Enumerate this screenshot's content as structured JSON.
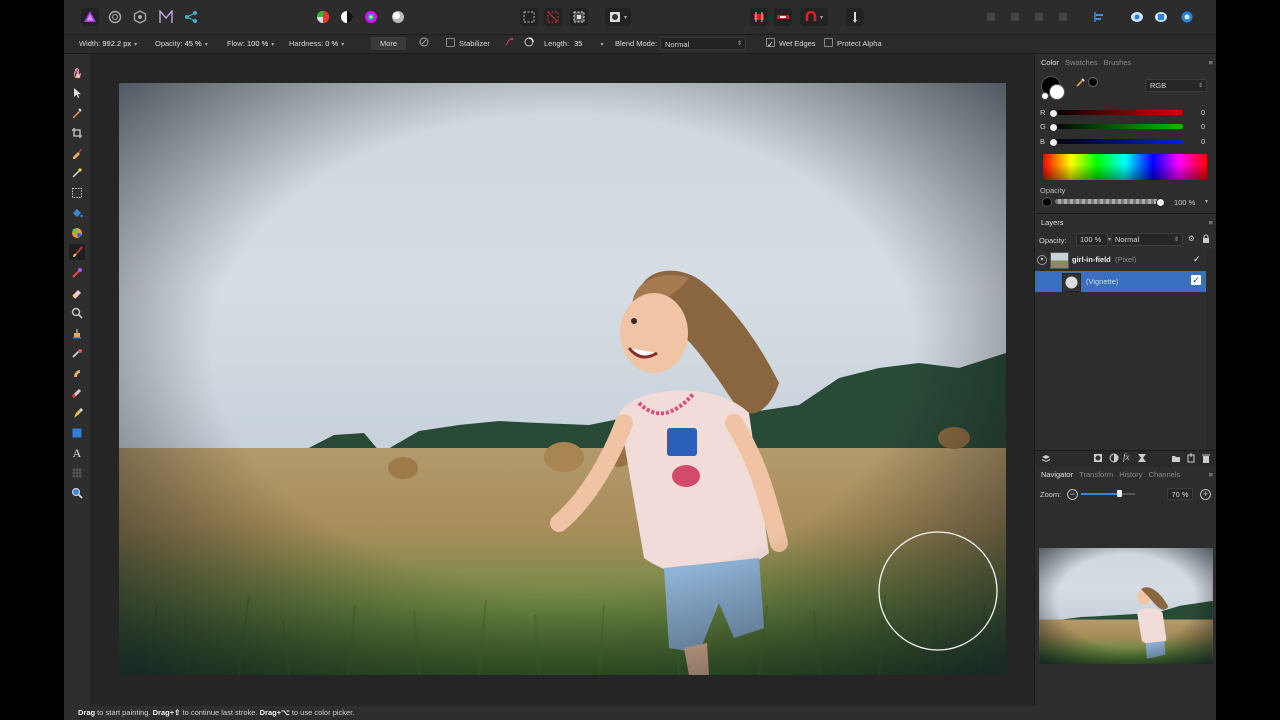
{
  "context_bar": {
    "width_label": "Width:",
    "width_value": "992.2 px",
    "opacity_label": "Opacity:",
    "opacity_value": "45 %",
    "flow_label": "Flow:",
    "flow_value": "100 %",
    "hardness_label": "Hardness:",
    "hardness_value": "0 %",
    "more_label": "More",
    "stabilizer_label": "Stabilizer",
    "length_label": "Length:",
    "length_value": "35",
    "blend_label": "Blend Mode:",
    "blend_value": "Normal",
    "wet_edges_label": "Wet Edges",
    "wet_edges_checked": true,
    "protect_alpha_label": "Protect Alpha",
    "protect_alpha_checked": false
  },
  "color_panel": {
    "tabs": [
      "Color",
      "Swatches",
      "Brushes"
    ],
    "active_tab": "Color",
    "model": "RGB",
    "channels": [
      {
        "label": "R",
        "value": "0",
        "color": "#c40000"
      },
      {
        "label": "G",
        "value": "0",
        "color": "#00b400"
      },
      {
        "label": "B",
        "value": "0",
        "color": "#0018d8"
      }
    ],
    "opacity_label": "Opacity",
    "opacity_value": "100 %"
  },
  "layers_panel": {
    "title": "Layers",
    "opacity_label": "Opacity:",
    "opacity_value": "100 %",
    "blend_value": "Normal",
    "layers": [
      {
        "name": "girl-in-field",
        "type": "(Pixel)",
        "visible": "✓"
      },
      {
        "name": "",
        "type": "(Vignette)",
        "visible": "✓"
      }
    ]
  },
  "navigator_panel": {
    "tabs": [
      "Navigator",
      "Transform",
      "History",
      "Channels"
    ],
    "active_tab": "Navigator",
    "zoom_label": "Zoom:",
    "zoom_value": "70 %",
    "zoom_level": 0.7
  },
  "status_bar": {
    "part1_bold": "Drag",
    "part1": " to start painting. ",
    "part2_bold": "Drag+⇧",
    "part2": " to continue last stroke. ",
    "part3_bold": "Drag+⌥",
    "part3": " to use color picker."
  }
}
